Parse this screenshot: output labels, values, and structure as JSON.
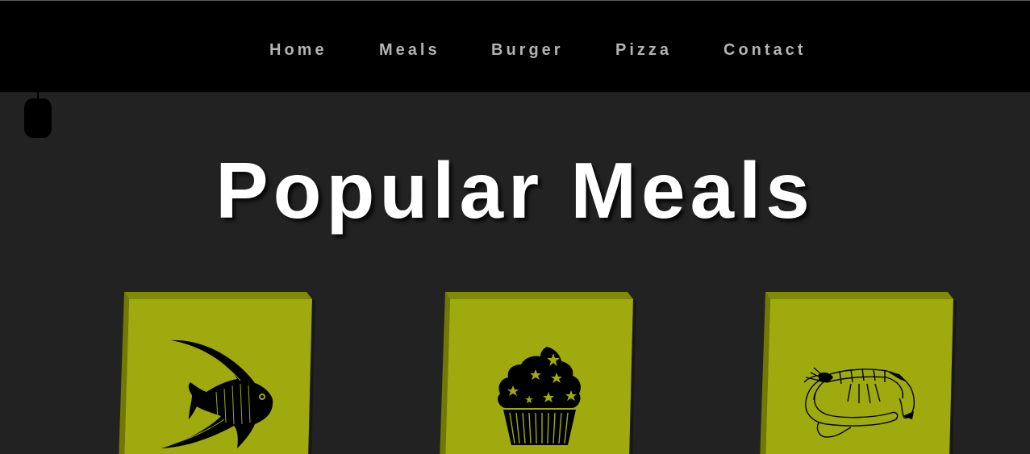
{
  "nav": {
    "items": [
      {
        "label": "Home"
      },
      {
        "label": "Meals"
      },
      {
        "label": "Burger"
      },
      {
        "label": "Pizza"
      },
      {
        "label": "Contact"
      }
    ]
  },
  "main": {
    "title": "Popular Meals",
    "cards": [
      {
        "icon": "fish-icon"
      },
      {
        "icon": "cupcake-icon"
      },
      {
        "icon": "shrimp-icon"
      }
    ]
  },
  "colors": {
    "nav_background": "#000000",
    "page_background": "#222222",
    "nav_text": "#b3b3b3",
    "title_text": "#ffffff",
    "card_face": "#9eaa0d",
    "card_edge_top": "#7f8a05",
    "card_edge_left": "#6f7903"
  }
}
